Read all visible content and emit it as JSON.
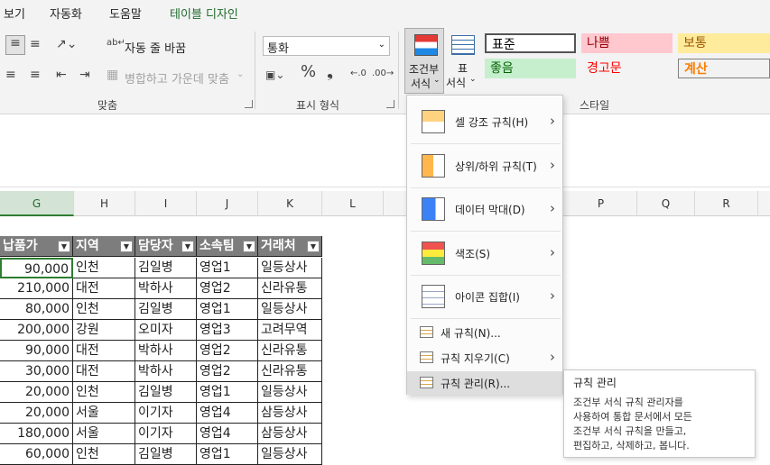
{
  "tabs": [
    "보기",
    "자동화",
    "도움말",
    "테이블 디자인"
  ],
  "ribbon": {
    "wrap_text": "자동 줄 바꿈",
    "merge_center": "병합하고 가운데 맞춤",
    "number_format_value": "통화",
    "conditional_format_line1": "조건부",
    "conditional_format_line2": "서식",
    "format_as_table_line1": "표",
    "format_as_table_line2": "서식",
    "groups": {
      "alignment": "맞춤",
      "number": "표시 형식",
      "styles": "스타일"
    },
    "styles": [
      {
        "label": "표준",
        "bg": "#ffffff",
        "color": "#000000"
      },
      {
        "label": "나쁨",
        "bg": "#ffc7ce",
        "color": "#9c0006"
      },
      {
        "label": "보통",
        "bg": "#ffeb9c",
        "color": "#9c5700"
      },
      {
        "label": "좋음",
        "bg": "#c6efce",
        "color": "#006100"
      },
      {
        "label": "경고문",
        "bg": "#f3f3f3",
        "color": "#ff0000"
      },
      {
        "label": "계산",
        "bg": "#f2f2f2",
        "color": "#fa7d00"
      }
    ]
  },
  "columns": [
    "G",
    "H",
    "I",
    "J",
    "K",
    "L",
    "P",
    "Q",
    "R"
  ],
  "table": {
    "headers": [
      "납품가",
      "지역",
      "담당자",
      "소속팀",
      "거래처"
    ],
    "rows": [
      [
        "90,000",
        "인천",
        "김일병",
        "영업1",
        "일등상사"
      ],
      [
        "210,000",
        "대전",
        "박하사",
        "영업2",
        "신라유통"
      ],
      [
        "80,000",
        "인천",
        "김일병",
        "영업1",
        "일등상사"
      ],
      [
        "200,000",
        "강원",
        "오미자",
        "영업3",
        "고려무역"
      ],
      [
        "90,000",
        "대전",
        "박하사",
        "영업2",
        "신라유통"
      ],
      [
        "30,000",
        "대전",
        "박하사",
        "영업2",
        "신라유통"
      ],
      [
        "20,000",
        "인천",
        "김일병",
        "영업1",
        "일등상사"
      ],
      [
        "20,000",
        "서울",
        "이기자",
        "영업4",
        "삼등상사"
      ],
      [
        "180,000",
        "서울",
        "이기자",
        "영업4",
        "삼등상사"
      ],
      [
        "60,000",
        "인천",
        "김일병",
        "영업1",
        "일등상사"
      ]
    ]
  },
  "menu": {
    "items": [
      {
        "label": "셀 강조 규칙(H)",
        "has_submenu": true
      },
      {
        "label": "상위/하위 규칙(T)",
        "has_submenu": true
      },
      {
        "label": "데이터 막대(D)",
        "has_submenu": true
      },
      {
        "label": "색조(S)",
        "has_submenu": true
      },
      {
        "label": "아이콘 집합(I)",
        "has_submenu": true
      },
      {
        "label": "새 규칙(N)...",
        "has_submenu": false
      },
      {
        "label": "규칙 지우기(C)",
        "has_submenu": true
      },
      {
        "label": "규칙 관리(R)...",
        "has_submenu": false
      }
    ]
  },
  "tooltip": {
    "title": "규칙 관리",
    "body": [
      "조건부 서식 규칙 관리자를",
      "사용하여 통합 문서에서 모든",
      "조건부 서식 규칙을 만들고,",
      "편집하고, 삭제하고, 봅니다."
    ]
  }
}
